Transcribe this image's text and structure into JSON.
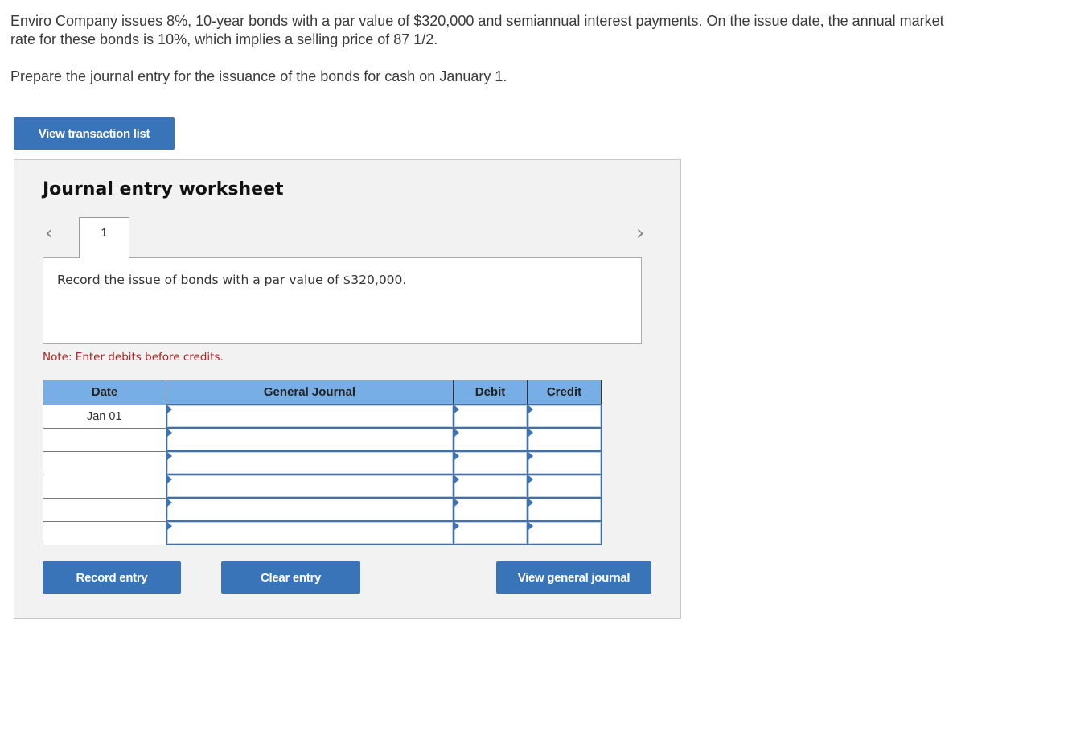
{
  "question": {
    "paragraph1": "Enviro Company issues 8%, 10-year bonds with a par value of $320,000 and semiannual interest payments. On the issue date, the annual market rate for these bonds is 10%, which implies a selling price of 87 1/2.",
    "paragraph2": "Prepare the journal entry for the issuance of the bonds for cash on January 1."
  },
  "buttons": {
    "view_transaction_list": "View transaction list",
    "record_entry": "Record entry",
    "clear_entry": "Clear entry",
    "view_general_journal": "View general journal"
  },
  "worksheet": {
    "title": "Journal entry worksheet",
    "nav_prev_icon": "‹",
    "nav_next_icon": "›",
    "active_tab": "1",
    "instruction": "Record the issue of bonds with a par value of $320,000.",
    "note": "Note: Enter debits before credits.",
    "table": {
      "headers": [
        "Date",
        "General Journal",
        "Debit",
        "Credit"
      ],
      "rows": [
        {
          "date": "Jan 01",
          "account": "",
          "debit": "",
          "credit": ""
        },
        {
          "date": "",
          "account": "",
          "debit": "",
          "credit": ""
        },
        {
          "date": "",
          "account": "",
          "debit": "",
          "credit": ""
        },
        {
          "date": "",
          "account": "",
          "debit": "",
          "credit": ""
        },
        {
          "date": "",
          "account": "",
          "debit": "",
          "credit": ""
        },
        {
          "date": "",
          "account": "",
          "debit": "",
          "credit": ""
        }
      ]
    }
  },
  "colors": {
    "button_blue": "#3a74b8",
    "header_blue": "#77aee6",
    "note_red": "#b22222",
    "panel_gray": "#f2f2f2"
  }
}
